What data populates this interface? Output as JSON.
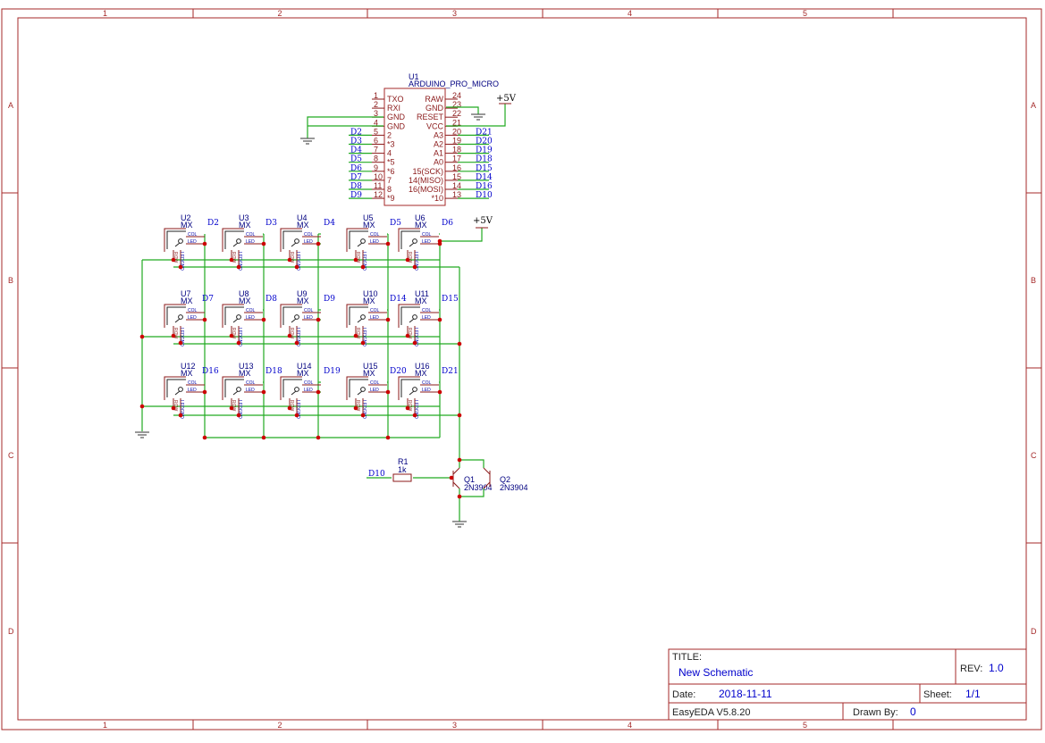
{
  "frame": {
    "columns": [
      "1",
      "2",
      "3",
      "4",
      "5"
    ],
    "rows": [
      "A",
      "B",
      "C",
      "D"
    ]
  },
  "mcu": {
    "ref": "U1",
    "value": "ARDUINO_PRO_MICRO",
    "left_pins": [
      {
        "num": "1",
        "name": "TXO",
        "net": ""
      },
      {
        "num": "2",
        "name": "RXI",
        "net": ""
      },
      {
        "num": "3",
        "name": "GND",
        "net": ""
      },
      {
        "num": "4",
        "name": "GND",
        "net": ""
      },
      {
        "num": "5",
        "name": "2",
        "net": "D2"
      },
      {
        "num": "6",
        "name": "*3",
        "net": "D3"
      },
      {
        "num": "7",
        "name": "4",
        "net": "D4"
      },
      {
        "num": "8",
        "name": "*5",
        "net": "D5"
      },
      {
        "num": "9",
        "name": "*6",
        "net": "D6"
      },
      {
        "num": "10",
        "name": "7",
        "net": "D7"
      },
      {
        "num": "11",
        "name": "8",
        "net": "D8"
      },
      {
        "num": "12",
        "name": "*9",
        "net": "D9"
      }
    ],
    "right_pins": [
      {
        "num": "24",
        "name": "RAW",
        "net": ""
      },
      {
        "num": "23",
        "name": "GND",
        "net": ""
      },
      {
        "num": "22",
        "name": "RESET",
        "net": ""
      },
      {
        "num": "21",
        "name": "VCC",
        "net": ""
      },
      {
        "num": "20",
        "name": "A3",
        "net": "D21"
      },
      {
        "num": "19",
        "name": "A2",
        "net": "D20"
      },
      {
        "num": "18",
        "name": "A1",
        "net": "D19"
      },
      {
        "num": "17",
        "name": "A0",
        "net": "D18"
      },
      {
        "num": "16",
        "name": "15(SCK)",
        "net": "D15"
      },
      {
        "num": "15",
        "name": "14(MISO)",
        "net": "D14"
      },
      {
        "num": "14",
        "name": "16(MOSI)",
        "net": "D16"
      },
      {
        "num": "13",
        "name": "*10",
        "net": "D10"
      }
    ]
  },
  "power_labels": {
    "mcu": "+5V",
    "matrix": "+5V"
  },
  "switches": [
    {
      "ref": "U2",
      "value": "MX",
      "net": "D2"
    },
    {
      "ref": "U3",
      "value": "MX",
      "net": "D3"
    },
    {
      "ref": "U4",
      "value": "MX",
      "net": "D4"
    },
    {
      "ref": "U5",
      "value": "MX",
      "net": "D5"
    },
    {
      "ref": "U6",
      "value": "MX",
      "net": "D6"
    },
    {
      "ref": "U7",
      "value": "MX",
      "net": "D7"
    },
    {
      "ref": "U8",
      "value": "MX",
      "net": "D8"
    },
    {
      "ref": "U9",
      "value": "MX",
      "net": "D9"
    },
    {
      "ref": "U10",
      "value": "MX",
      "net": "D14"
    },
    {
      "ref": "U11",
      "value": "MX",
      "net": "D15"
    },
    {
      "ref": "U12",
      "value": "MX",
      "net": "D16"
    },
    {
      "ref": "U13",
      "value": "MX",
      "net": "D18"
    },
    {
      "ref": "U14",
      "value": "MX",
      "net": "D19"
    },
    {
      "ref": "U15",
      "value": "MX",
      "net": "D20"
    },
    {
      "ref": "U16",
      "value": "MX",
      "net": "D21"
    }
  ],
  "switch_pin_labels": {
    "col": "COL",
    "led": "LED",
    "row": "ROW",
    "ledgnd": "LEDGND"
  },
  "resistor": {
    "ref": "R1",
    "value": "1k",
    "net": "D10"
  },
  "transistors": [
    {
      "ref": "Q1",
      "value": "2N3904"
    },
    {
      "ref": "Q2",
      "value": "2N3904"
    }
  ],
  "title_block": {
    "title_label": "TITLE:",
    "title": "New Schematic",
    "rev_label": "REV:",
    "rev": "1.0",
    "date_label": "Date:",
    "date": "2018-11-11",
    "sheet_label": "Sheet:",
    "sheet": "1/1",
    "software": "EasyEDA V5.8.20",
    "drawn_label": "Drawn By:",
    "drawn": "0"
  }
}
